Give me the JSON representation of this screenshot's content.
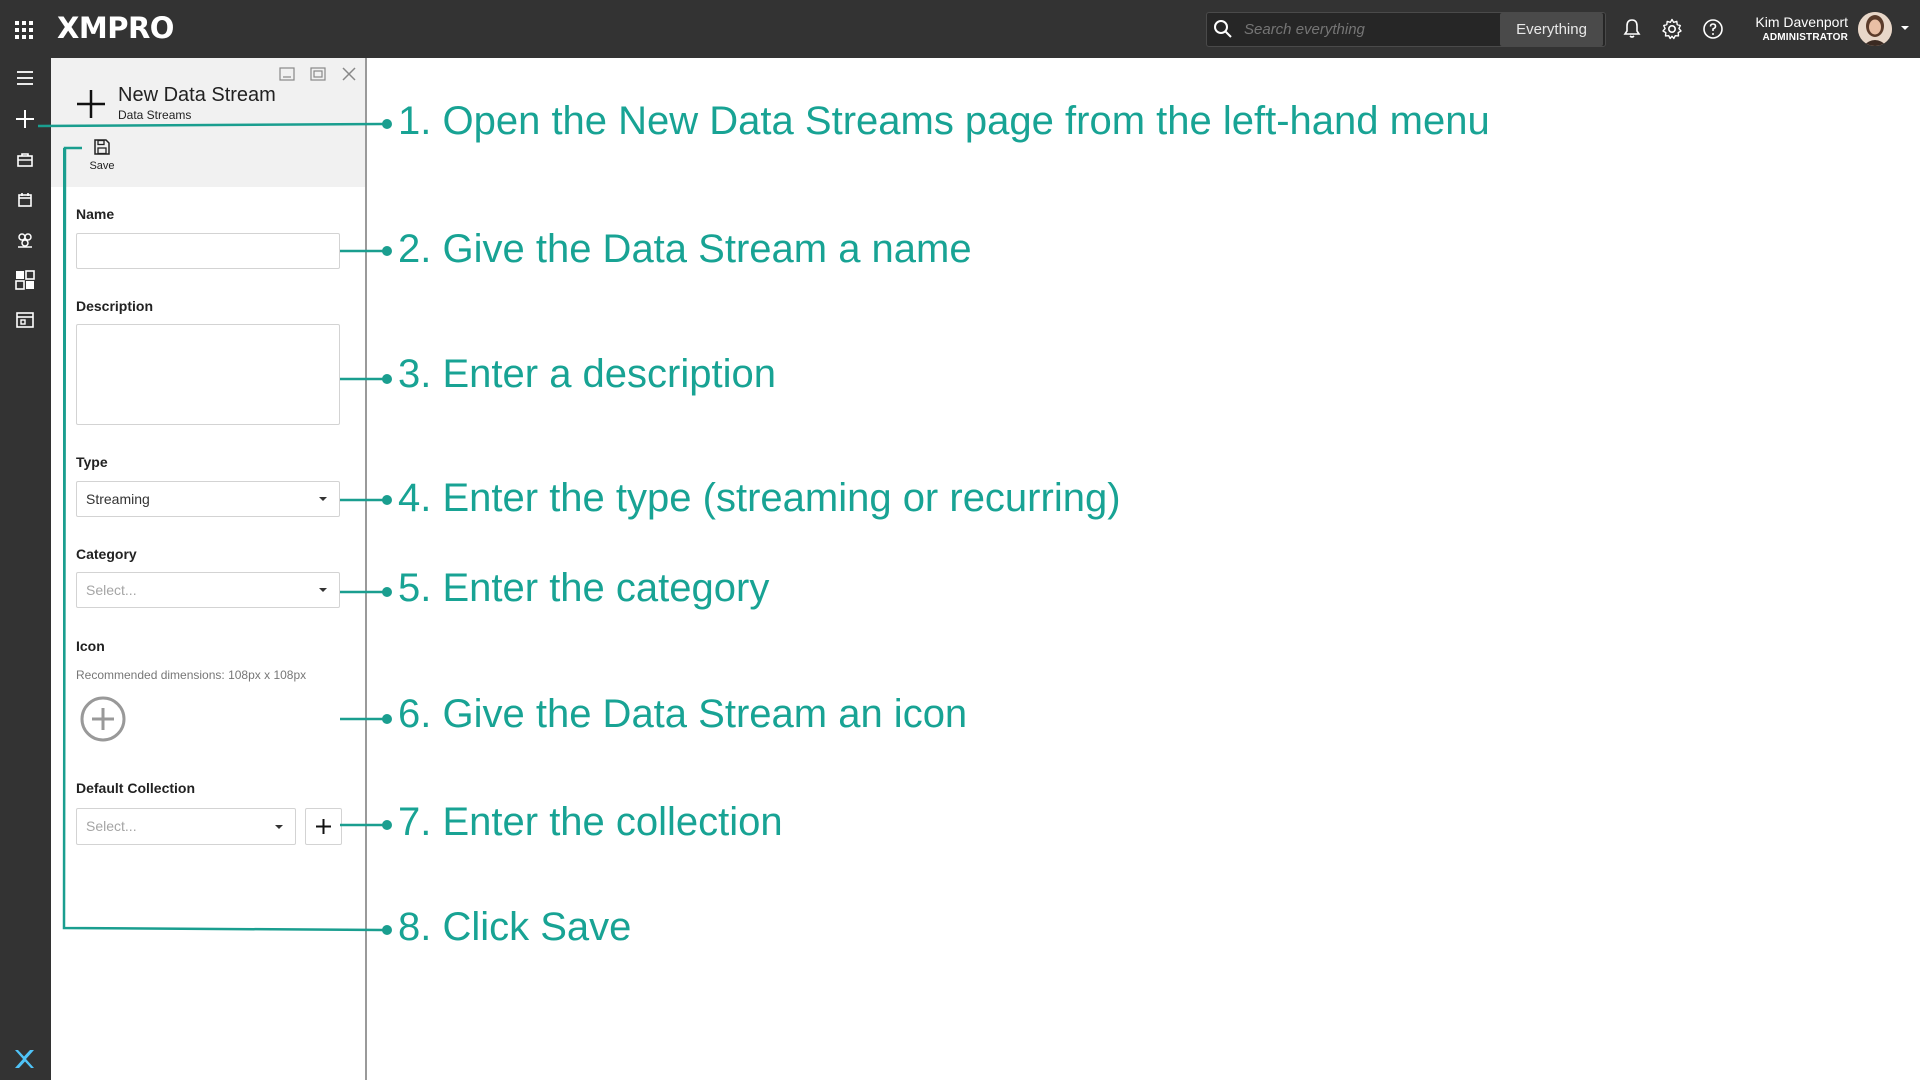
{
  "app": {
    "logo_text": "XMPRO",
    "brand_color": "#333333",
    "accent_color": "#18a394"
  },
  "search": {
    "placeholder": "Search everything",
    "scope": "Everything"
  },
  "user": {
    "name": "Kim Davenport",
    "role": "ADMINISTRATOR"
  },
  "left_rail": {
    "items": [
      {
        "icon": "hamburger-menu-icon"
      },
      {
        "icon": "plus-icon"
      },
      {
        "icon": "briefcase-icon"
      },
      {
        "icon": "calendar-icon"
      },
      {
        "icon": "recommendations-icon"
      },
      {
        "icon": "dashboard-icon"
      },
      {
        "icon": "data-stream-icon"
      }
    ],
    "bottom_logo_icon": "x-logo-icon"
  },
  "panel": {
    "title": "New Data Stream",
    "subtitle": "Data Streams",
    "save_label": "Save",
    "fields": {
      "name": {
        "label": "Name",
        "value": ""
      },
      "description": {
        "label": "Description",
        "value": ""
      },
      "type": {
        "label": "Type",
        "value": "Streaming"
      },
      "category": {
        "label": "Category",
        "placeholder": "Select..."
      },
      "icon": {
        "label": "Icon",
        "hint": "Recommended dimensions: 108px x 108px"
      },
      "default_collection": {
        "label": "Default Collection",
        "placeholder": "Select..."
      }
    }
  },
  "annotations": [
    "1. Open the New Data Streams page from the left-hand menu",
    "2. Give the Data Stream a name",
    "3. Enter a description",
    "4. Enter the type (streaming or recurring)",
    "5. Enter the category",
    "6. Give the Data Stream an icon",
    "7. Enter the collection",
    "8. Click Save"
  ]
}
